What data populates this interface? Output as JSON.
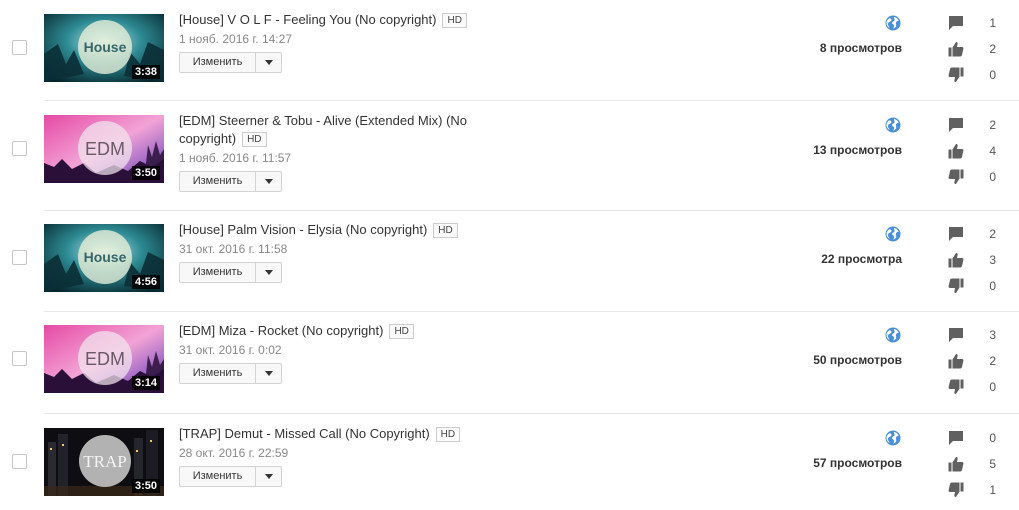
{
  "videos": [
    {
      "title": "[House] V O L F - Feeling You (No copyright)",
      "hd": "HD",
      "date": "1 нояб. 2016 г. 14:27",
      "duration": "3:38",
      "thumb_text": "House",
      "thumb_style": "house",
      "edit_label": "Изменить",
      "visibility_icon": "globe-icon",
      "views": "8 просмотров",
      "comments": "1",
      "likes": "2",
      "dislikes": "0"
    },
    {
      "title": "[EDM] Steerner & Tobu - Alive (Extended Mix) (No copyright)",
      "hd": "HD",
      "date": "1 нояб. 2016 г. 11:57",
      "duration": "3:50",
      "thumb_text": "EDM",
      "thumb_style": "edm",
      "edit_label": "Изменить",
      "visibility_icon": "globe-icon",
      "views": "13 просмотров",
      "comments": "2",
      "likes": "4",
      "dislikes": "0"
    },
    {
      "title": "[House] Palm Vision - Elysia (No copyright)",
      "hd": "HD",
      "date": "31 окт. 2016 г. 11:58",
      "duration": "4:56",
      "thumb_text": "House",
      "thumb_style": "house",
      "edit_label": "Изменить",
      "visibility_icon": "globe-icon",
      "views": "22 просмотра",
      "comments": "2",
      "likes": "3",
      "dislikes": "0"
    },
    {
      "title": "[EDM] Miza - Rocket (No copyright)",
      "hd": "HD",
      "date": "31 окт. 2016 г. 0:02",
      "duration": "3:14",
      "thumb_text": "EDM",
      "thumb_style": "edm",
      "edit_label": "Изменить",
      "visibility_icon": "globe-icon",
      "views": "50 просмотров",
      "comments": "3",
      "likes": "2",
      "dislikes": "0"
    },
    {
      "title": "[TRAP] Demut - Missed Call (No Copyright)",
      "hd": "HD",
      "date": "28 окт. 2016 г. 22:59",
      "duration": "3:50",
      "thumb_text": "TRAP",
      "thumb_style": "trap",
      "edit_label": "Изменить",
      "visibility_icon": "globe-icon",
      "views": "57 просмотров",
      "comments": "0",
      "likes": "5",
      "dislikes": "1"
    }
  ],
  "colors": {
    "globe": "#4a8fd9",
    "icon_gray": "#606060",
    "separator": "#e8e8e8"
  }
}
